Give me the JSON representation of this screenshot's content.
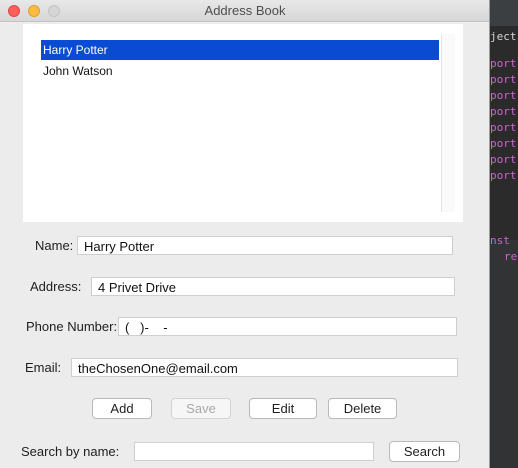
{
  "window": {
    "title": "Address Book"
  },
  "contacts": [
    {
      "name": "Harry Potter",
      "selected": true
    },
    {
      "name": "John Watson",
      "selected": false
    }
  ],
  "form": {
    "name_label": "Name:",
    "name_value": "Harry Potter",
    "address_label": "Address:",
    "address_value": "4 Privet Drive",
    "phone_label": "Phone Number:",
    "phone_value": "(   )-    -",
    "email_label": "Email:",
    "email_value": "theChosenOne@email.com"
  },
  "buttons": {
    "add": "Add",
    "save": "Save",
    "edit": "Edit",
    "delete": "Delete"
  },
  "search": {
    "label": "Search by name:",
    "value": "",
    "button": "Search"
  },
  "editor_fragments": {
    "l1": "ject",
    "l2": "port",
    "l3": "port",
    "l4": "port",
    "l5": "port",
    "l6": "port",
    "l7": "port",
    "l8": "port",
    "l9": "port",
    "l10": "nst",
    "l11": "re"
  }
}
